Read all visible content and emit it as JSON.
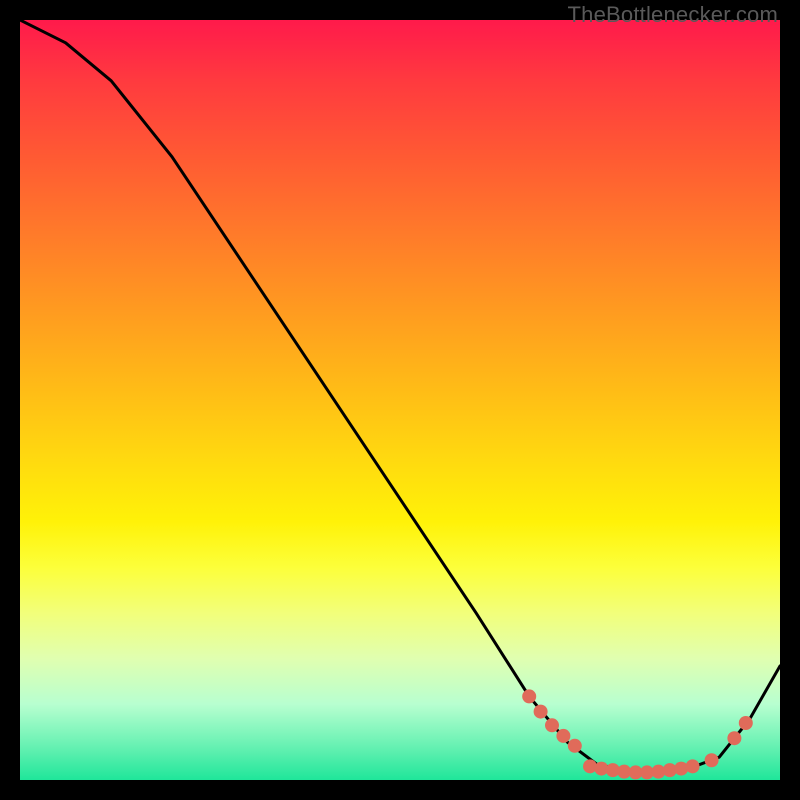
{
  "watermark": "TheBottlenecker.com",
  "chart_data": {
    "type": "line",
    "title": "",
    "xlabel": "",
    "ylabel": "",
    "xlim": [
      0,
      100
    ],
    "ylim": [
      0,
      100
    ],
    "grid": false,
    "legend": false,
    "series": [
      {
        "name": "curve",
        "x": [
          0,
          6,
          12,
          20,
          30,
          40,
          50,
          60,
          67,
          72,
          76,
          82,
          88,
          92,
          96,
          100
        ],
        "y": [
          100,
          97,
          92,
          82,
          67,
          52,
          37,
          22,
          11,
          5,
          2,
          1,
          1.5,
          3,
          8,
          15
        ]
      }
    ],
    "markers": {
      "name": "dots",
      "color_hex": "#e06b5a",
      "points": [
        {
          "x": 67.0,
          "y": 11.0
        },
        {
          "x": 68.5,
          "y": 9.0
        },
        {
          "x": 70.0,
          "y": 7.2
        },
        {
          "x": 71.5,
          "y": 5.8
        },
        {
          "x": 73.0,
          "y": 4.5
        },
        {
          "x": 75.0,
          "y": 1.8
        },
        {
          "x": 76.5,
          "y": 1.5
        },
        {
          "x": 78.0,
          "y": 1.3
        },
        {
          "x": 79.5,
          "y": 1.1
        },
        {
          "x": 81.0,
          "y": 1.0
        },
        {
          "x": 82.5,
          "y": 1.0
        },
        {
          "x": 84.0,
          "y": 1.1
        },
        {
          "x": 85.5,
          "y": 1.3
        },
        {
          "x": 87.0,
          "y": 1.5
        },
        {
          "x": 88.5,
          "y": 1.8
        },
        {
          "x": 91.0,
          "y": 2.6
        },
        {
          "x": 94.0,
          "y": 5.5
        },
        {
          "x": 95.5,
          "y": 7.5
        }
      ]
    }
  }
}
